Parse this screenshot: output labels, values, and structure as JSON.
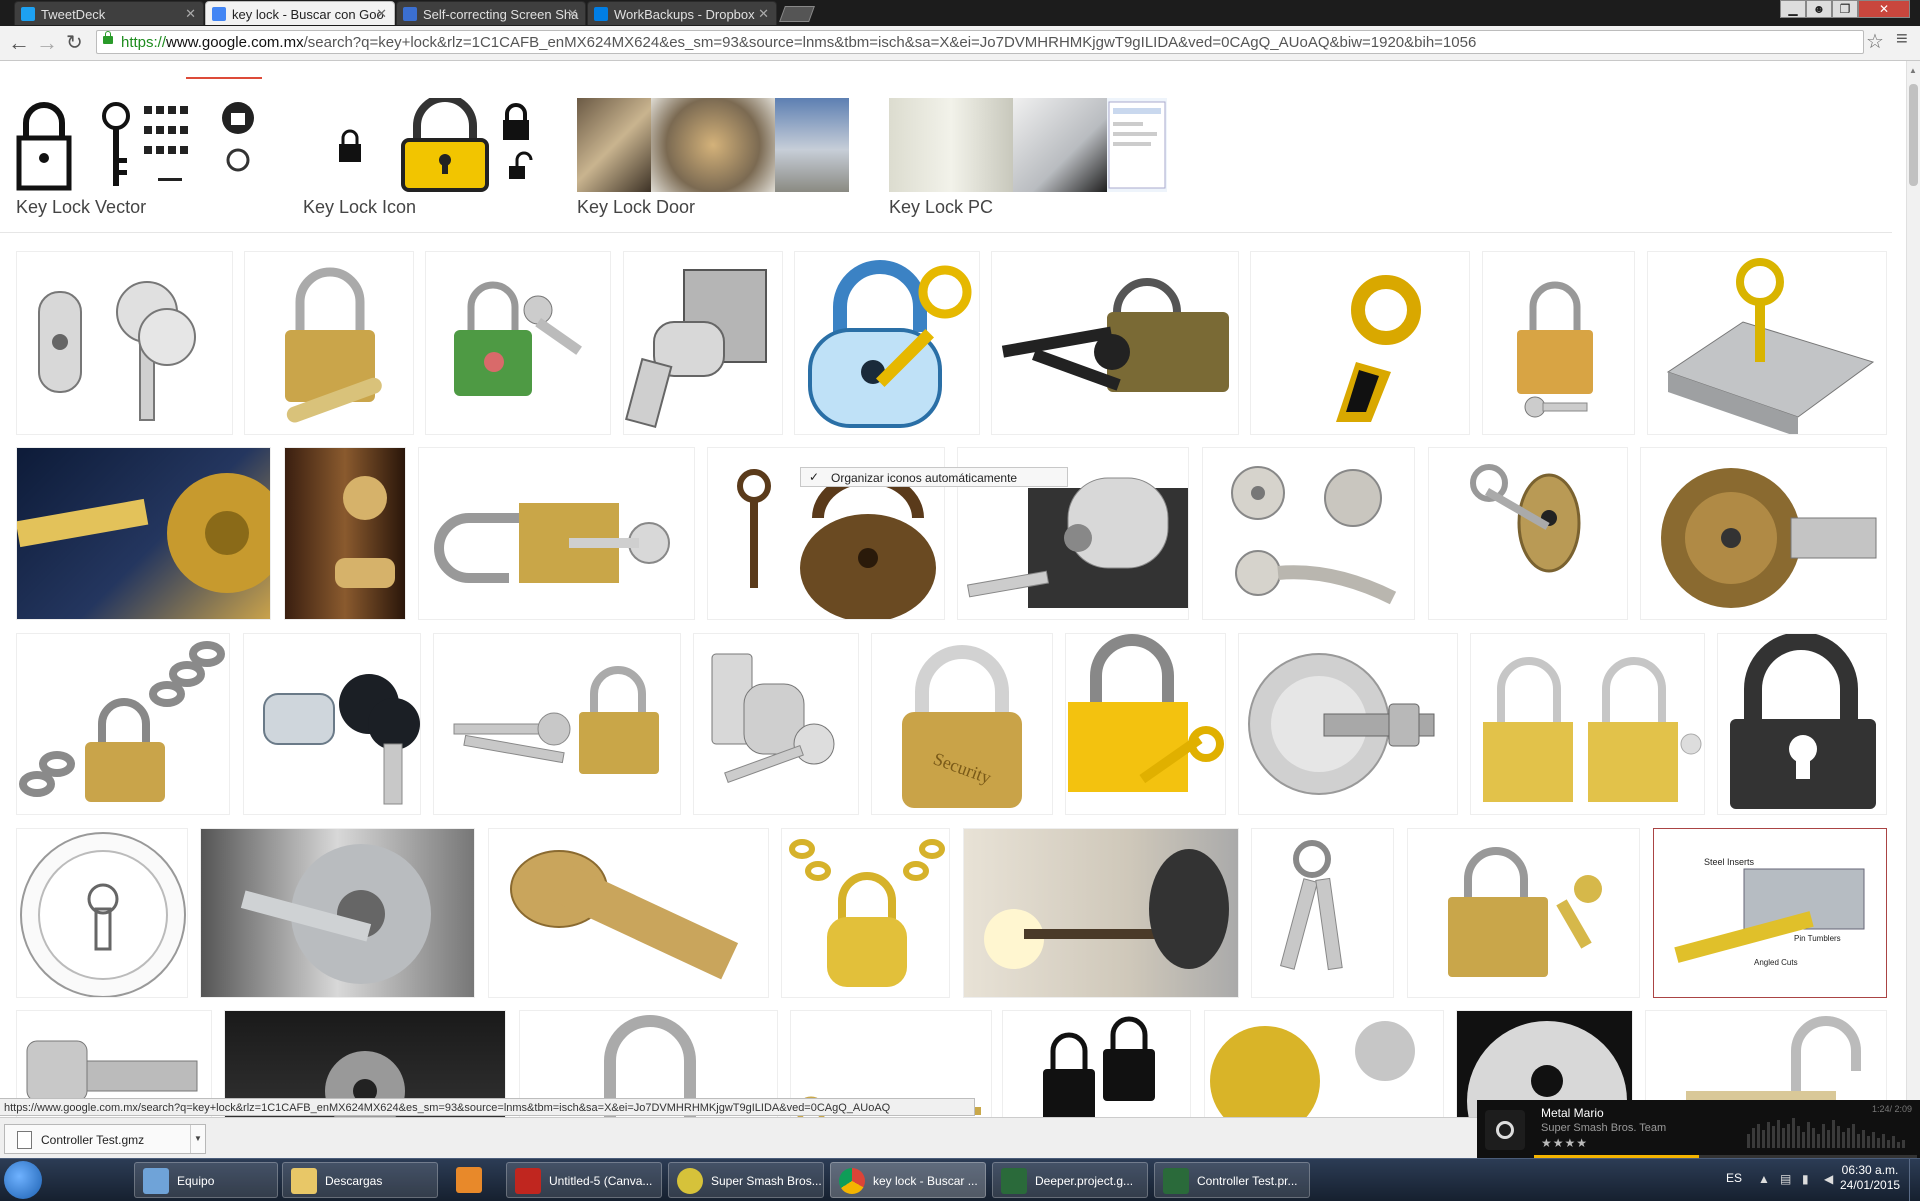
{
  "browser": {
    "tabs": [
      {
        "label": "TweetDeck",
        "icon": "tweetdeck-icon",
        "color": "#1da1f2",
        "active": false
      },
      {
        "label": "key lock - Buscar con Goo",
        "icon": "google-icon",
        "color": "#4285f4",
        "active": true
      },
      {
        "label": "Self-correcting Screen Sha",
        "icon": "page-icon",
        "color": "#3b6fd0",
        "active": false
      },
      {
        "label": "WorkBackups - Dropbox",
        "icon": "dropbox-icon",
        "color": "#007ee5",
        "active": false
      }
    ],
    "url_scheme": "https://",
    "url_host": "www.google.com.mx",
    "url_rest": "/search?q=key+lock&rlz=1C1CAFB_enMX624MX624&es_sm=93&source=lnms&tbm=isch&sa=X&ei=Jo7DVMHRHMKjgwT9gILIDA&ved=0CAgQ_AUoAQ&biw=1920&bih=1056"
  },
  "related_searches": [
    {
      "label": "Key Lock Vector"
    },
    {
      "label": "Key Lock Icon"
    },
    {
      "label": "Key Lock Door"
    },
    {
      "label": "Key Lock PC"
    }
  ],
  "context_popup": {
    "check": "✓",
    "label": "Organizar iconos automáticamente"
  },
  "status_url": "https://www.google.com.mx/search?q=key+lock&rlz=1C1CAFB_enMX624MX624&es_sm=93&source=lnms&tbm=isch&sa=X&ei=Jo7DVMHRHMKjgwT9gILIDA&ved=0CAgQ_AUoAQ",
  "downloads": {
    "file": "Controller Test.gmz"
  },
  "music": {
    "title": "Metal Mario",
    "artist": "Super Smash Bros. Team",
    "rating": "★★★★",
    "time": "1:24/ 2:09",
    "progress": 0.43
  },
  "taskbar": {
    "items": [
      {
        "label": "Equipo",
        "icon": "computer-icon"
      },
      {
        "label": "Descargas",
        "icon": "folder-icon"
      },
      {
        "label": "",
        "icon": "media-player-icon"
      },
      {
        "label": "Untitled-5 (Canva...",
        "icon": "flash-icon"
      },
      {
        "label": "Super Smash Bros...",
        "icon": "smash-icon"
      },
      {
        "label": "key lock - Buscar ...",
        "icon": "chrome-icon"
      },
      {
        "label": "Deeper.project.g...",
        "icon": "gamemaker-icon"
      },
      {
        "label": "Controller Test.pr...",
        "icon": "gamemaker-icon"
      }
    ],
    "language": "ES",
    "time": "06:30 a.m.",
    "date": "24/01/2015"
  }
}
